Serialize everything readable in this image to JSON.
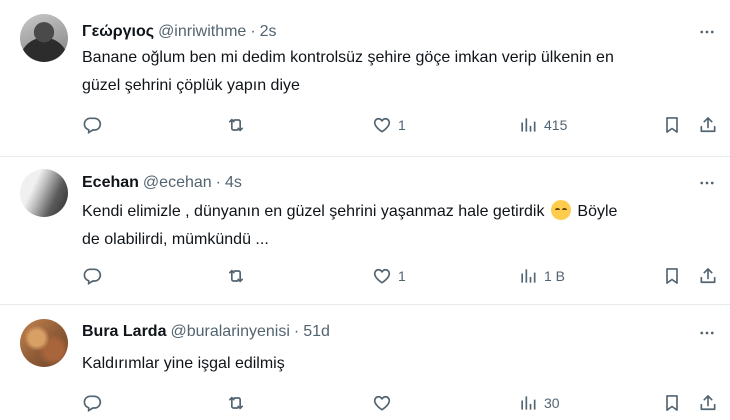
{
  "tweets": [
    {
      "name": "Γεώργιος",
      "handle": "@inriwithme",
      "separator": "·",
      "time": "2s",
      "text_line1": "Banane oğlum ben mi dedim kontrolsüz şehire göçe imkan verip ülkenin en",
      "text_line2": "güzel şehrini çöplük yapın diye",
      "likes": "1",
      "views": "415"
    },
    {
      "name": "Ecehan",
      "handle": "@ecehan",
      "separator": "·",
      "time": "4s",
      "text_line1_a": "Kendi elimizle , dünyanın en güzel şehrini yaşanmaz hale getirdik",
      "emoji": "pensive-face",
      "text_line1_b": "Böyle",
      "text_line2": "de olabilirdi, mümkündü ...",
      "likes": "1",
      "views": "1 B"
    },
    {
      "name": "Bura Larda",
      "handle": "@buralarinyenisi",
      "separator": "·",
      "time": "51d",
      "text_line1": "Kaldırımlar yine işgal edilmiş",
      "views": "30"
    }
  ],
  "icons": {
    "reply": "reply-icon",
    "retweet": "retweet-icon",
    "like": "heart-icon",
    "views": "views-icon",
    "bookmark": "bookmark-icon",
    "share": "share-icon",
    "more": "more-icon"
  },
  "colors": {
    "text": "#0f1419",
    "secondary": "#536471",
    "divider": "#e7ebee"
  }
}
